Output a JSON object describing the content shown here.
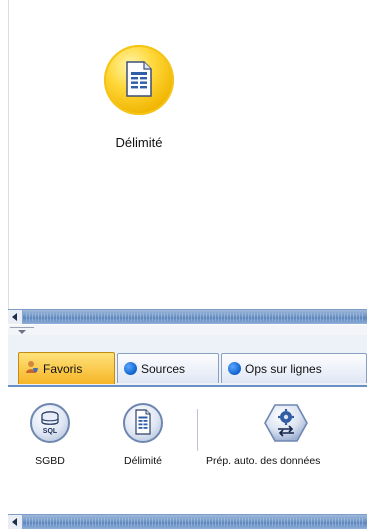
{
  "canvas": {
    "node": {
      "label": "Délimité",
      "icon": "delimited-file-icon"
    }
  },
  "palette": {
    "tabs": [
      {
        "label": "Favoris",
        "icon": "favorites-user-icon",
        "active": true
      },
      {
        "label": "Sources",
        "icon": "blue-dot-icon",
        "active": false
      },
      {
        "label": "Ops sur lignes",
        "icon": "blue-dot-icon",
        "active": false
      }
    ],
    "items": [
      {
        "label": "SGBD",
        "icon": "database-sql-icon",
        "icon_text": "SQL"
      },
      {
        "label": "Délimité",
        "icon": "delimited-file-icon"
      },
      {
        "label": "Prép. auto. des données",
        "icon": "auto-data-prep-icon"
      }
    ]
  },
  "colors": {
    "node_fill": "#f5c000",
    "active_tab": "#f6b526",
    "scrollbar": "#6f95c6",
    "blue_dot": "#0f62cc"
  }
}
